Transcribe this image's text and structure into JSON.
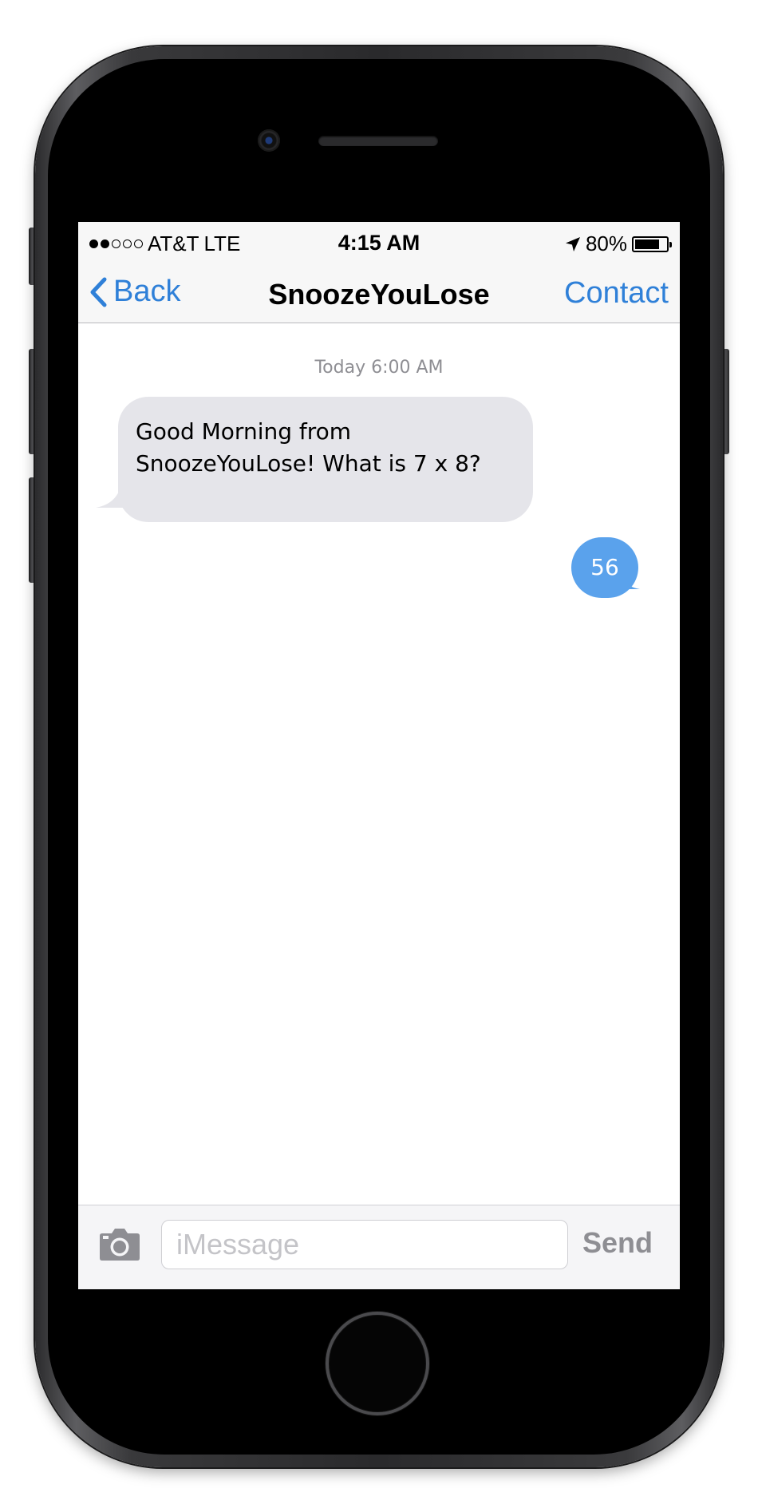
{
  "status_bar": {
    "signal_filled": 2,
    "signal_total": 5,
    "carrier": "AT&T",
    "network": "LTE",
    "time": "4:15 AM",
    "battery_percent": "80%",
    "battery_level": 0.8,
    "location_icon": "location-arrow-icon",
    "battery_icon": "battery-icon"
  },
  "nav": {
    "back_label": "Back",
    "back_icon": "chevron-left-icon",
    "title": "SnoozeYouLose",
    "contact_label": "Contact"
  },
  "conversation": {
    "timestamp": "Today 6:00 AM",
    "messages": [
      {
        "direction": "incoming",
        "text": "Good Morning from SnoozeYouLose! What is 7 x 8?"
      },
      {
        "direction": "outgoing",
        "text": "56"
      }
    ]
  },
  "input_bar": {
    "camera_icon": "camera-icon",
    "placeholder": "iMessage",
    "value": "",
    "send_label": "Send"
  },
  "colors": {
    "accent_blue": "#2f80d8",
    "outgoing_bubble": "#5aa2ec",
    "incoming_bubble": "#e5e5ea",
    "muted_text": "#8e8e93"
  }
}
